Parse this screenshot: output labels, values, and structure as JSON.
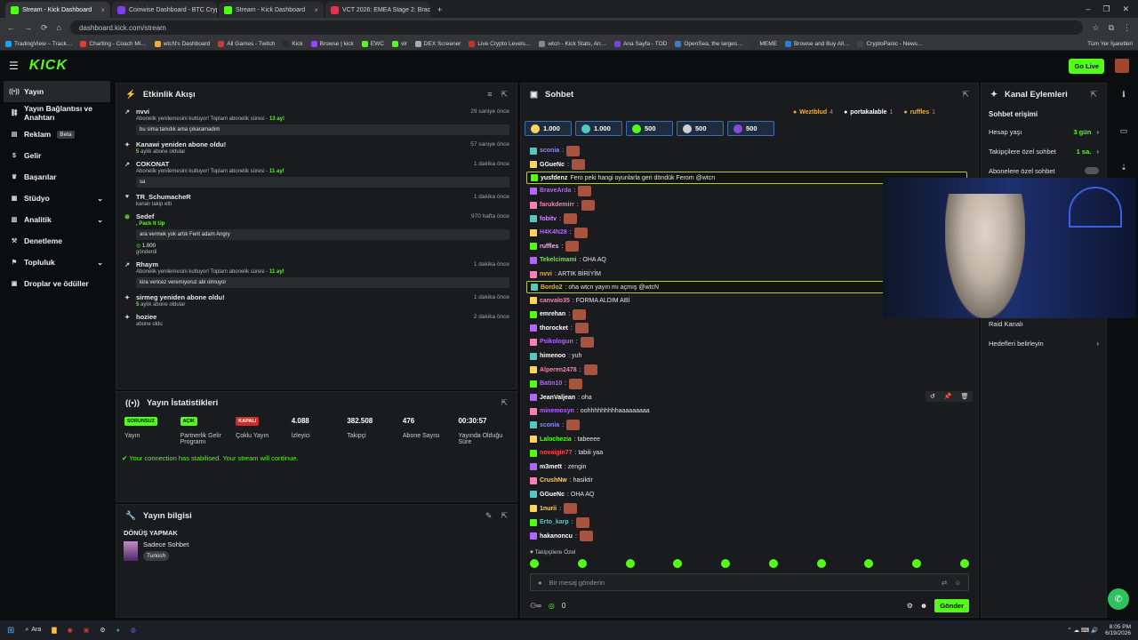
{
  "browser": {
    "tabs": [
      {
        "title": "Stream - Kick Dashboard",
        "active": true,
        "color": "#53fc18"
      },
      {
        "title": "Coinwise Dashboard - BTC Cryp",
        "active": false,
        "color": "#7b3fe4"
      },
      {
        "title": "Stream - Kick Dashboard",
        "active": false,
        "color": "#53fc18"
      },
      {
        "title": "VCT 2026: EMEA Stage 2: Brack",
        "active": false,
        "color": "#e0334f"
      }
    ],
    "url": "dashboard.kick.com/stream",
    "bookmarks": [
      "TradingView – Track…",
      "Charting - Coach Mi…",
      "wtcN's Dashboard",
      "All Games - Twitch",
      "Kick",
      "Browse | kick",
      "EWC",
      "vlr",
      "DEX Screener",
      "Live Crypto Levels…",
      "wtcn - Kick Stats, An…",
      "Ana Sayfa - TOD",
      "OpenSea, the larges…",
      "MEME",
      "Browse and Buy All…",
      "CryptoPanic - News…"
    ],
    "all_bookmarks": "Tüm Yer İşaretleri"
  },
  "header": {
    "logo": "KICK",
    "go_live": "Go Live"
  },
  "sidebar": {
    "items": [
      {
        "label": "Yayın",
        "icon": "broadcast-icon",
        "active": true
      },
      {
        "label": "Yayın Bağlantısı ve Anahtarı",
        "icon": "link-icon"
      },
      {
        "label": "Reklam",
        "icon": "ad-icon",
        "badge": "Beta"
      },
      {
        "label": "Gelir",
        "icon": "revenue-icon"
      },
      {
        "label": "Başarılar",
        "icon": "trophy-icon"
      },
      {
        "label": "Stüdyo",
        "icon": "studio-icon",
        "expand": true
      },
      {
        "label": "Analitik",
        "icon": "analytics-icon",
        "expand": true
      },
      {
        "label": "Denetleme",
        "icon": "moderation-icon"
      },
      {
        "label": "Topluluk",
        "icon": "community-icon",
        "expand": true
      },
      {
        "label": "Droplar ve ödüller",
        "icon": "drops-icon"
      }
    ]
  },
  "activity": {
    "title": "Etkinlik Akışı",
    "items": [
      {
        "user": "nvvi",
        "time": "29 saniye önce",
        "sub": "Abonelik yenilemesini kutluyor! Toplam abonelik süresi -",
        "highlight": "13 ay!",
        "msg": "bu sima tanıdık ama çıkaramadım"
      },
      {
        "user": "Kanawi yeniden abone oldu!",
        "time": "57 saniye önce",
        "highlight": "5",
        "sub": "aylık abone oldular"
      },
      {
        "user": "COKONAT",
        "time": "1 dakika önce",
        "sub": "Abonelik yenilemesini kutluyor! Toplam abonelik süresi -",
        "highlight": "11 ay!",
        "msg": "sa"
      },
      {
        "user": "TR_SchumacheR",
        "time": "1 dakika önce",
        "sub": "kanalı takip etti"
      },
      {
        "user": "Sedef",
        "time": "970 hafta önce",
        "highlight": ", Pack It Up",
        "msg": "ara vermek yok artık Ferit adam Angry",
        "amount": "1.000",
        "sub2": "gönderdi"
      },
      {
        "user": "Rhaym",
        "time": "1 dakika önce",
        "sub": "Abonelik yenilemesini kutluyor! Toplam abonelik süresi -",
        "highlight": "11 ay!",
        "msg": "kira vericez veremiyoruz abi olmuyor"
      },
      {
        "user": "sirmeg yeniden abone oldu!",
        "time": "1 dakika önce",
        "highlight": "5",
        "sub": "aylık abone oldular"
      },
      {
        "user": "hoziee",
        "time": "2 dakika önce",
        "sub": "abone oldu"
      }
    ]
  },
  "stats": {
    "title": "Yayın İstatistikleri",
    "cols": [
      {
        "badge": "SORUNSUZ",
        "badge_color": "#53fc18",
        "label": "Yayın"
      },
      {
        "badge": "AÇIK",
        "badge_color": "#53fc18",
        "label": "Partnerlik Gelir Programı"
      },
      {
        "badge": "KAPALI",
        "badge_color": "#d12c2c",
        "label": "Çoklu Yayın"
      },
      {
        "value": "4.088",
        "label": "İzleyici"
      },
      {
        "value": "382.508",
        "label": "Takipçi"
      },
      {
        "value": "476",
        "label": "Abone Sayısı"
      },
      {
        "value": "00:30:57",
        "label": "Yayında Olduğu Süre"
      }
    ],
    "connection": "Your connection has stabilised. Your stream will continue."
  },
  "info": {
    "title": "Yayın bilgisi",
    "stream_title": "DÖNÜŞ YAPMAK",
    "category": "Sadece Sohbet",
    "tag": "Turkish"
  },
  "chat": {
    "title": "Sohbet",
    "top_users": [
      {
        "name": "Weztblud",
        "count": "4",
        "color": "#e8b04a"
      },
      {
        "name": "portakalable",
        "count": "1",
        "color": "#ffffff"
      },
      {
        "name": "ruffles",
        "count": "1",
        "color": "#e8b04a"
      }
    ],
    "gifts": [
      {
        "value": "1.000",
        "color": "#ffd45a"
      },
      {
        "value": "1.000",
        "color": "#54c7c2"
      },
      {
        "value": "500",
        "color": "#53fc18"
      },
      {
        "value": "500",
        "color": "#d0d0d0"
      },
      {
        "value": "500",
        "color": "#8a4bd8"
      }
    ],
    "messages": [
      {
        "user": "sconia",
        "color": "#8a8cf0",
        "text": ":",
        "emote": true
      },
      {
        "user": "GGueNc",
        "color": "#ffffff",
        "text": ":",
        "emote": true
      },
      {
        "user": "yusfdenz",
        "color": "#ffffff",
        "text": "Fero peki hangi oyunlarla geri döndük Ferom @wtcn",
        "highlight": true
      },
      {
        "user": "BraveArda",
        "color": "#b266ff",
        "text": ":",
        "emote": true
      },
      {
        "user": "farukdemirr",
        "color": "#ff7eb6",
        "text": ":",
        "emote": true
      },
      {
        "user": "fobitv",
        "color": "#d08bff",
        "text": ":",
        "emote": true
      },
      {
        "user": "H4K4N28",
        "color": "#b266ff",
        "text": ":",
        "emote": true
      },
      {
        "user": "ruffles",
        "color": "#ffa6ff",
        "text": ":",
        "emote": true
      },
      {
        "user": "Tekelcimami",
        "color": "#53fc18",
        "text": ": OHA AQ"
      },
      {
        "user": "nvvi",
        "color": "#e8b04a",
        "text": ": ARTIK BİRİYİM"
      },
      {
        "user": "Bordo2",
        "color": "#e8b04a",
        "text": ": oha wtcn yayın mı açmış @wtcN",
        "highlight": true
      },
      {
        "user": "canvalo35",
        "color": "#ff7eb6",
        "text": ": FORMA ALDIM ABİ"
      },
      {
        "user": "emrehan",
        "color": "#ffffff",
        "text": ":",
        "emote": true
      },
      {
        "user": "thorocket",
        "color": "#ffffff",
        "text": ":",
        "emote": true
      },
      {
        "user": "Psikologun",
        "color": "#b266ff",
        "text": ":",
        "emote": true
      },
      {
        "user": "himenoo",
        "color": "#ffffff",
        "text": ": yuh"
      },
      {
        "user": "Alperen2478",
        "color": "#ff7eb6",
        "text": ":",
        "emote": true
      },
      {
        "user": "Batin10",
        "color": "#b266ff",
        "text": ":",
        "emote": true
      },
      {
        "user": "JeanValjean",
        "color": "#ffffff",
        "text": ": oha"
      },
      {
        "user": "minemosyn",
        "color": "#b266ff",
        "text": ": oohhhhhhhhhaaaaaaaaa"
      },
      {
        "user": "sconia",
        "color": "#8a8cf0",
        "text": ":",
        "emote": true
      },
      {
        "user": "Lalochezia",
        "color": "#53fc18",
        "text": ": tabeeee"
      },
      {
        "user": "novaigin77",
        "color": "#ff4444",
        "text": ": tabiii yaa"
      },
      {
        "user": "m3mett",
        "color": "#ffffff",
        "text": ": zengin"
      },
      {
        "user": "CrushNw",
        "color": "#ffd45a",
        "text": ": hasiktir"
      },
      {
        "user": "GGueNc",
        "color": "#ffffff",
        "text": ": OHA AQ"
      },
      {
        "user": "1nurii",
        "color": "#ffd45a",
        "text": ":",
        "emote": true
      },
      {
        "user": "Erto_karp",
        "color": "#54c7c2",
        "text": ":",
        "emote": true
      },
      {
        "user": "hakanoncu",
        "color": "#ffffff",
        "text": ":",
        "emote": true
      }
    ],
    "followers_only": "Takipçilere Özel",
    "placeholder": "Bir mesaj gönderin",
    "footer_count": "0",
    "send": "Gönder"
  },
  "actions": {
    "title": "Kanal Eylemleri",
    "section": "Sohbet erişimi",
    "items": [
      {
        "label": "Hesap yaşı",
        "value": "3 gün"
      },
      {
        "label": "Takipçilere özel sohbet",
        "value": "1 sa."
      },
      {
        "label": "Abonelere özel sohbet",
        "value": ""
      },
      {
        "label": "Raid Kanalı",
        "value": ""
      },
      {
        "label": "Hedefleri belirleyin",
        "value": ""
      }
    ]
  },
  "taskbar": {
    "search": "Ara",
    "time": "8:05 PM",
    "date": "6/19/2026"
  }
}
